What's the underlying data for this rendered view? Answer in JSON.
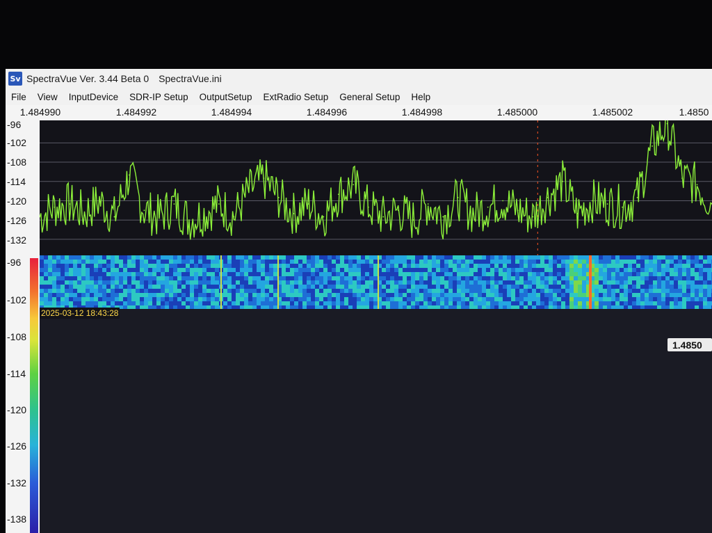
{
  "window": {
    "app_title": "SpectraVue Ver. 3.44 Beta 0",
    "config_file": "SpectraVue.ini",
    "icon_text": "Sv"
  },
  "menu": [
    "File",
    "View",
    "InputDevice",
    "SDR-IP Setup",
    "OutputSetup",
    "ExtRadio Setup",
    "General Setup",
    "Help"
  ],
  "frequency_axis": [
    "1.484990",
    "1.484992",
    "1.484994",
    "1.484996",
    "1.484998",
    "1.485000",
    "1.485002",
    "1.4850"
  ],
  "spectrum_amplitude_axis": [
    "-96",
    "-102",
    "-108",
    "-114",
    "-120",
    "-126",
    "-132"
  ],
  "waterfall_amplitude_axis": [
    "-96",
    "-102",
    "-108",
    "-114",
    "-120",
    "-126",
    "-132",
    "-138"
  ],
  "waterfall": {
    "timestamp": "2025-03-12 18:43:28"
  },
  "frequency_readout": "1.4850",
  "colors": {
    "trace": "#8cf03a",
    "marker": "#ff5522",
    "grid": "#5a5a66"
  },
  "icons": [
    "app-logo-icon"
  ],
  "chart_data": {
    "type": "line",
    "xlabel": "",
    "ylabel": "",
    "xlim": [
      1.48499,
      1.4850035
    ],
    "ylim": [
      -137,
      -95
    ],
    "center_marker": 1.485,
    "x": [
      1.48499,
      1.4849903,
      1.4849906,
      1.4849909,
      1.4849912,
      1.4849915,
      1.4849918,
      1.4849921,
      1.4849924,
      1.4849927,
      1.484993,
      1.4849933,
      1.4849936,
      1.4849939,
      1.4849942,
      1.4849945,
      1.4849948,
      1.4849951,
      1.4849954,
      1.4849957,
      1.484996,
      1.4849963,
      1.4849966,
      1.4849969,
      1.4849972,
      1.4849975,
      1.4849978,
      1.4849981,
      1.4849984,
      1.4849987,
      1.484999,
      1.4849993,
      1.4849996,
      1.4849999,
      1.4850002,
      1.4850005,
      1.4850008,
      1.4850011,
      1.4850014,
      1.4850017,
      1.485002,
      1.4850023,
      1.4850026,
      1.4850029,
      1.4850032,
      1.4850035
    ],
    "y": [
      -125,
      -122,
      -121,
      -124,
      -120,
      -125,
      -112,
      -123,
      -125,
      -121,
      -126,
      -124,
      -121,
      -125,
      -117,
      -113,
      -119,
      -124,
      -121,
      -125,
      -118,
      -115,
      -122,
      -125,
      -123,
      -126,
      -121,
      -125,
      -119,
      -124,
      -122,
      -120,
      -123,
      -125,
      -119,
      -114,
      -124,
      -120,
      -121,
      -122,
      -119,
      -103,
      -96,
      -113,
      -115,
      -121
    ]
  }
}
